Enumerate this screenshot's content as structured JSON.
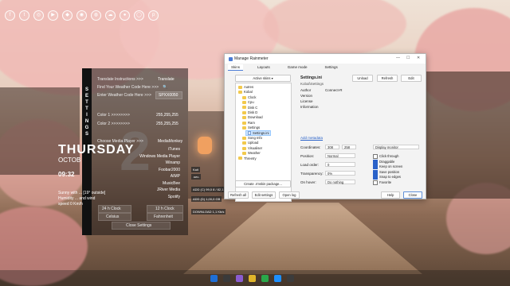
{
  "desktop": {
    "top_icon_names": [
      "facebook-icon",
      "twitter-icon",
      "instagram-icon",
      "youtube-icon",
      "twitch-icon",
      "steam-icon",
      "discord-icon",
      "soundcloud-icon",
      "reddit-icon",
      "globe-icon",
      "pinterest-icon"
    ],
    "top_icon_glyphs": [
      "f",
      "t",
      "◎",
      "▶",
      "◆",
      "◉",
      "◍",
      "☁",
      "●",
      "◯",
      "p"
    ]
  },
  "rm_panel": {
    "strip_letters": [
      "S",
      "E",
      "T",
      "T",
      "I",
      "N",
      "G",
      "S"
    ],
    "rows": [
      {
        "label": "Translate Instructions >>>",
        "value": "Translate"
      },
      {
        "label": "Find Your Weather Code Here >>>",
        "value": "🔍"
      },
      {
        "label": "Enter Weather Code Here >>>",
        "value": "SPXX0050"
      },
      {
        "label": "Color 1 >>>>>>>>",
        "value": "255,255,255"
      },
      {
        "label": "Color 2 >>>>>>>>",
        "value": "255,255,255"
      },
      {
        "label": "Choose Media Player >>>",
        "value": "MediaMonkey"
      }
    ],
    "players": [
      "iTunes",
      "Windows Media Player",
      "Winamp",
      "Foobar2000",
      "AIMP",
      "MusicBee",
      "JRiver Media",
      "Spotify"
    ],
    "clock24": "24 h Clock",
    "clock12": "12 h Clock",
    "celsius": "Celsius",
    "fahrenheit": "Fahrenheit",
    "close": "Close Settings"
  },
  "big_clock": {
    "day": "THURSDAY",
    "month": "OCTOB",
    "time": "09:32",
    "digit": "2",
    "weather": "Sunny with ... [19° outside] Humidity ... and wind speed 0 Km/h"
  },
  "window": {
    "title": "Manage Rainmeter",
    "tabs": [
      "Skins",
      "Layouts",
      "Game mode",
      "Settings"
    ],
    "active_skins_btn": "Active skins ▾",
    "tree": [
      {
        "name": "Autres",
        "type": "folder",
        "indent": 0
      },
      {
        "name": "Kobal",
        "type": "folder",
        "indent": 0
      },
      {
        "name": "Clock",
        "type": "folder",
        "indent": 1
      },
      {
        "name": "Cpu",
        "type": "folder",
        "indent": 1
      },
      {
        "name": "Disk C",
        "type": "folder",
        "indent": 1
      },
      {
        "name": "Disk D",
        "type": "folder",
        "indent": 1
      },
      {
        "name": "Download",
        "type": "folder",
        "indent": 1
      },
      {
        "name": "Ram",
        "type": "folder",
        "indent": 1
      },
      {
        "name": "Settings",
        "type": "folder",
        "indent": 1
      },
      {
        "name": "Settings.ini",
        "type": "file",
        "indent": 2
      },
      {
        "name": "Song Info",
        "type": "folder",
        "indent": 1
      },
      {
        "name": "Upload",
        "type": "folder",
        "indent": 1
      },
      {
        "name": "Visualiser",
        "type": "folder",
        "indent": 1
      },
      {
        "name": "Weather",
        "type": "folder",
        "indent": 1
      },
      {
        "name": "Threetry",
        "type": "folder",
        "indent": 0
      }
    ],
    "header_title": "Settings.ini",
    "subtitle": "Kobal\\Settings",
    "unload": "Unload",
    "refresh": "Refresh",
    "edit": "Edit",
    "meta": [
      {
        "label": "Author",
        "value": "Connect-R"
      },
      {
        "label": "Version",
        "value": ""
      },
      {
        "label": "License",
        "value": ""
      },
      {
        "label": "Information",
        "value": ""
      }
    ],
    "add_metadata": "Add metadata",
    "coordinates_label": "Coordinates:",
    "coord_x": "308",
    "coord_y": "258",
    "position_label": "Position:",
    "position_val": "Normal",
    "load_order_label": "Load order:",
    "load_order_val": "0",
    "transparency_label": "Transparency:",
    "transparency_val": "0%",
    "on_hover_label": "On hover:",
    "on_hover_val": "Do nothing",
    "display_monitor": "Display monitor",
    "checks": [
      {
        "label": "Click through",
        "on": false
      },
      {
        "label": "Draggable",
        "on": true
      },
      {
        "label": "Keep on screen",
        "on": true
      },
      {
        "label": "Save position",
        "on": true
      },
      {
        "label": "Snap to edges",
        "on": true
      },
      {
        "label": "Favorite",
        "on": false
      }
    ],
    "create_pkg": "Create .rmskin package...",
    "refresh_all": "Refresh all",
    "edit_settings": "Edit settings",
    "open_log": "Open log",
    "help": "Help",
    "close": "Close"
  },
  "mini_skins": [
    "Kait",
    ".sec.",
    "ADD (C) 99,0 8 / 82,1 GB",
    "ADD (D) 1,00,0 GB",
    "DOWNLOAD 1,1 Kb/s"
  ],
  "taskbar_colors": [
    "#1f6fd6",
    "#3a3a3a",
    "#8a5cd0",
    "#e0b52a",
    "#2aa84a",
    "#1e90ff",
    "#3c3c3c"
  ]
}
